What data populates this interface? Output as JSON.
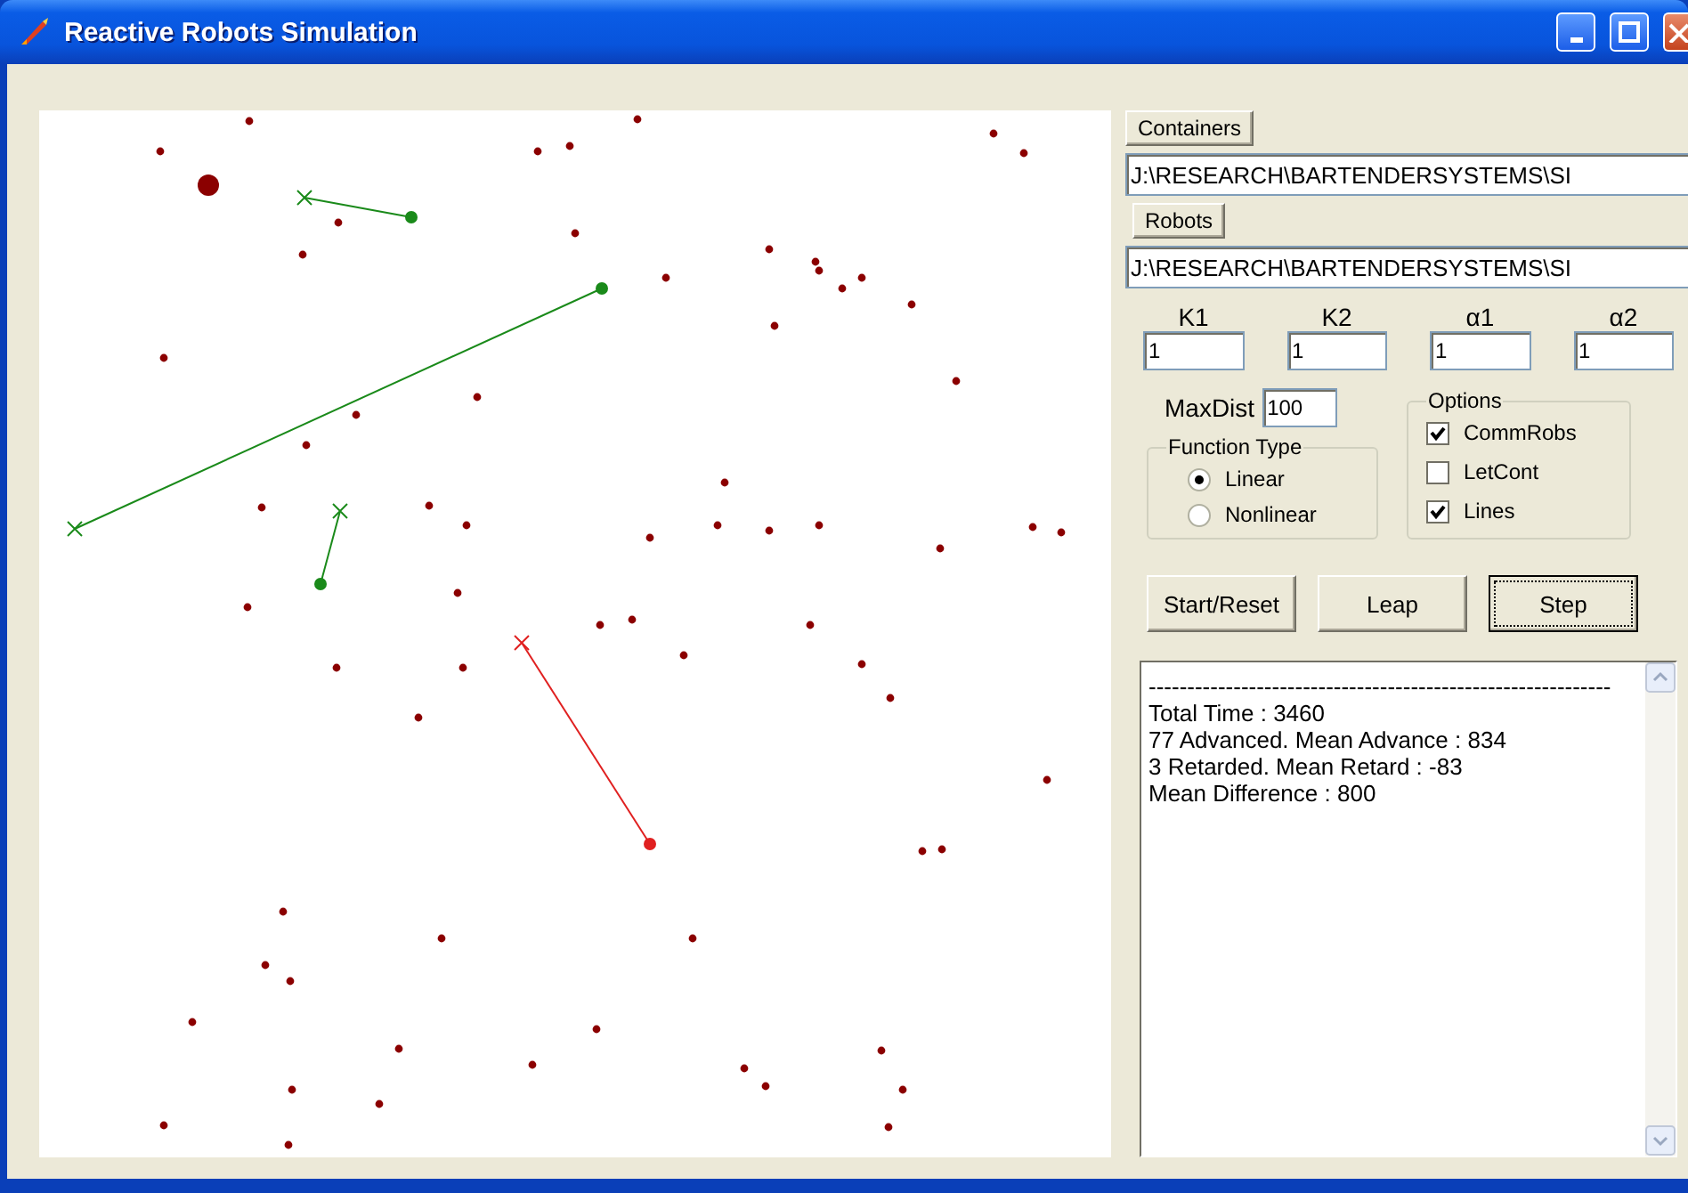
{
  "window": {
    "title": "Reactive Robots Simulation"
  },
  "containers": {
    "button": "Containers",
    "path": "J:\\RESEARCH\\BARTENDERSYSTEMS\\SI"
  },
  "robots": {
    "button": "Robots",
    "path": "J:\\RESEARCH\\BARTENDERSYSTEMS\\SI"
  },
  "parameters": [
    {
      "label": "K1",
      "value": "1"
    },
    {
      "label": "K2",
      "value": "1"
    },
    {
      "label": "α1",
      "value": "1"
    },
    {
      "label": "α2",
      "value": "1"
    }
  ],
  "max_dist": {
    "label": "MaxDist",
    "value": "100"
  },
  "function_type": {
    "title": "Function Type",
    "options": [
      {
        "label": "Linear",
        "selected": true
      },
      {
        "label": "Nonlinear",
        "selected": false
      }
    ]
  },
  "options": {
    "title": "Options",
    "items": [
      {
        "label": "CommRobs",
        "checked": true
      },
      {
        "label": "LetCont",
        "checked": false
      },
      {
        "label": "Lines",
        "checked": true
      }
    ]
  },
  "actions": [
    {
      "label": "Start/Reset",
      "focused": false
    },
    {
      "label": "Leap",
      "focused": false
    },
    {
      "label": "Step",
      "focused": true
    }
  ],
  "log": [
    "------------------------------------------------------------",
    "Total Time : 3460",
    "77 Advanced. Mean Advance : 834",
    "3 Retarded. Mean Retard : -83",
    "Mean Difference : 800"
  ]
}
